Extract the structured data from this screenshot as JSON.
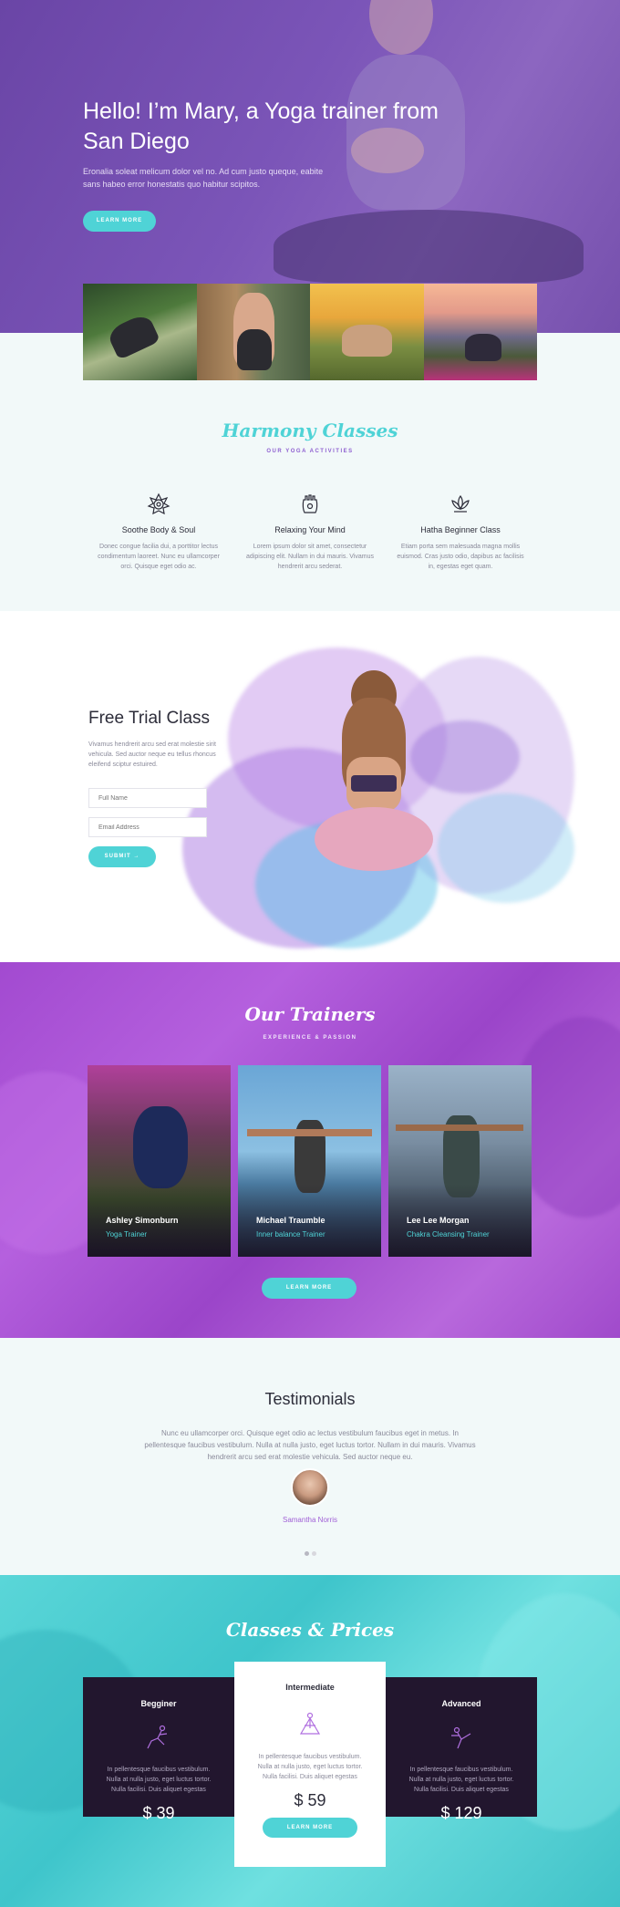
{
  "hero": {
    "title": "Hello! I’m Mary, a Yoga trainer from San Diego",
    "text": "Eronalia soleat melicum dolor vel no. Ad cum justo queque, eabite sans habeo error honestatis quo habitur scipitos.",
    "button": "Learn More"
  },
  "classes": {
    "title": "Harmony Classes",
    "subtitle": "Our Yoga Activities",
    "features": [
      {
        "icon": "lotus-mandala-icon",
        "title": "Soothe Body & Soul",
        "text": "Donec congue facilia dui, a porttitor lectus condimentum laoreet. Nunc eu ullamcorper orci. Quisque eget odio ac."
      },
      {
        "icon": "hamsa-hand-icon",
        "title": "Relaxing Your Mind",
        "text": "Lorem ipsum dolor sit amet, consectetur adipiscing elit. Nullam in dui mauris. Vivamus hendrerit arcu sederat."
      },
      {
        "icon": "lotus-flower-icon",
        "title": "Hatha Beginner Class",
        "text": "Etiam porta sem malesuada magna mollis euismod. Cras justo odio, dapibus ac facilisis in, egestas eget quam."
      }
    ]
  },
  "trial": {
    "title": "Free Trial Class",
    "text": "Vivamus hendrerit arcu sed erat molestie sirit vehicula. Sed auctor neque eu tellus rhoncus eleifend sciptur estuired.",
    "name_placeholder": "Full Name",
    "email_placeholder": "Email Address",
    "button": "Submit"
  },
  "trainers": {
    "title": "Our Trainers",
    "subtitle": "Experience & Passion",
    "people": [
      {
        "name": "Ashley Simonburn",
        "role": "Yoga Trainer"
      },
      {
        "name": "Michael Traumble",
        "role": "Inner balance Trainer"
      },
      {
        "name": "Lee Lee Morgan",
        "role": "Chakra Cleansing Trainer"
      }
    ],
    "button": "Learn More"
  },
  "testimonials": {
    "title": "Testimonials",
    "text": "Nunc eu ullamcorper orci. Quisque eget odio ac lectus vestibulum faucibus eget in metus. In pellentesque faucibus vestibulum. Nulla at nulla justo, eget luctus tortor. Nullam in dui mauris. Vivamus hendrerit arcu sed erat molestie vehicula. Sed auctor neque eu.",
    "name": "Samantha Norris"
  },
  "prices": {
    "title": "Classes & Prices",
    "plans": [
      {
        "name": "Begginer",
        "icon": "yoga-pose-icon",
        "text": "In pellentesque faucibus vestibulum. Nulla at nulla justo, eget luctus tortor. Nulla facilisi. Duis aliquet egestas",
        "price": "$ 39"
      },
      {
        "name": "Intermediate",
        "icon": "yoga-triangle-icon",
        "text": "In pellentesque faucibus vestibulum. Nulla at nulla justo, eget luctus tortor. Nulla facilisi. Duis aliquet egestas",
        "price": "$ 59",
        "button": "Learn More"
      },
      {
        "name": "Advanced",
        "icon": "yoga-balance-icon",
        "text": "In pellentesque faucibus vestibulum. Nulla at nulla justo, eget luctus tortor. Nulla facilisi. Duis aliquet egestas",
        "price": "$ 129"
      }
    ]
  },
  "colors": {
    "accent": "#4fd3d6",
    "purple": "#8e5fd0",
    "dark": "#22162e"
  }
}
